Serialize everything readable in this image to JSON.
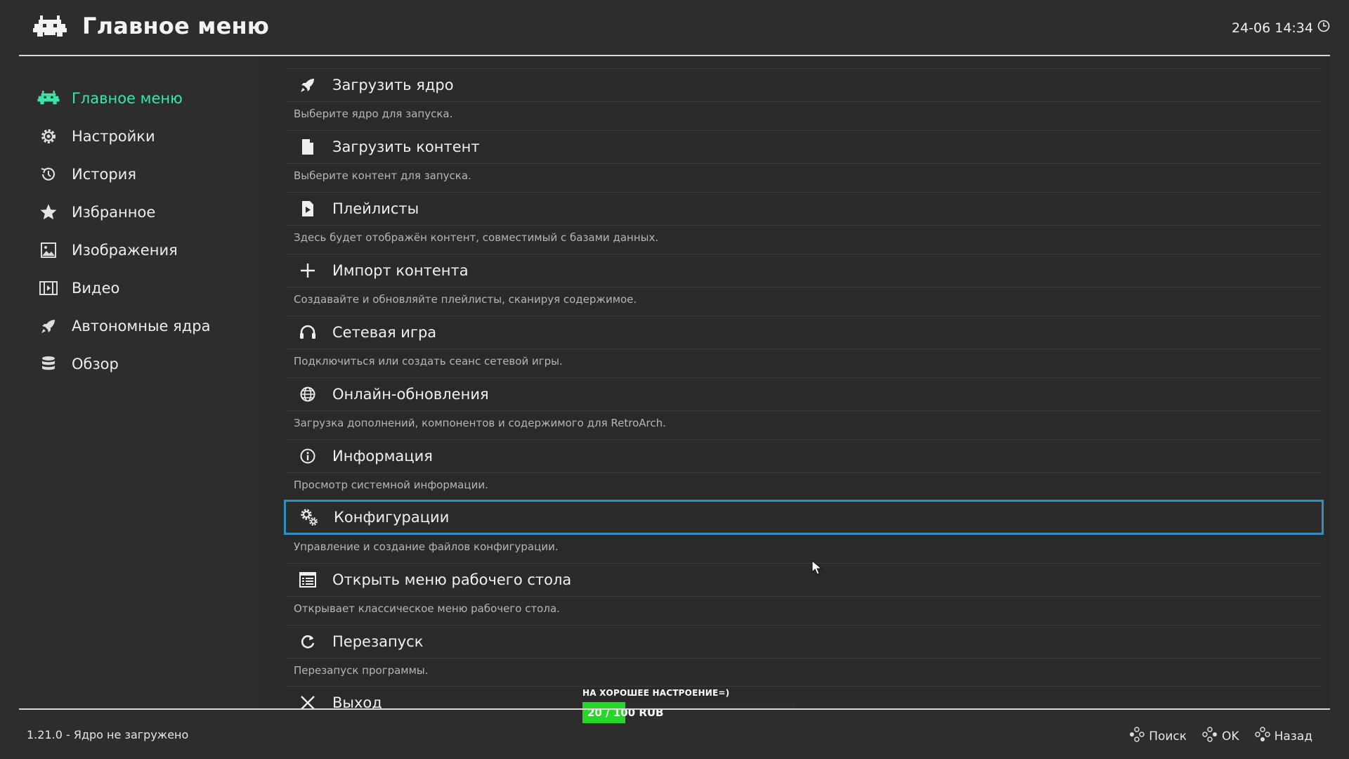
{
  "header": {
    "title": "Главное меню",
    "clock": "24-06 14:34",
    "logo_icon": "retroarch-invader-icon",
    "clock_icon": "clock-icon"
  },
  "sidebar": {
    "items": [
      {
        "label": "Главное меню",
        "icon": "retroarch-invader-icon",
        "active": true
      },
      {
        "label": "Настройки",
        "icon": "gear-icon"
      },
      {
        "label": "История",
        "icon": "history-icon"
      },
      {
        "label": "Избранное",
        "icon": "star-icon"
      },
      {
        "label": "Изображения",
        "icon": "image-icon"
      },
      {
        "label": "Видео",
        "icon": "film-icon"
      },
      {
        "label": "Автономные ядра",
        "icon": "rocket-icon"
      },
      {
        "label": "Обзор",
        "icon": "database-icon"
      }
    ],
    "active_color": "#3ae6a8"
  },
  "menu": {
    "items": [
      {
        "label": "Загрузить ядро",
        "desc": "Выберите ядро для запуска.",
        "icon": "rocket-icon"
      },
      {
        "label": "Загрузить контент",
        "desc": "Выберите контент для запуска.",
        "icon": "file-icon"
      },
      {
        "label": "Плейлисты",
        "desc": "Здесь будет отображён контент, совместимый с базами данных.",
        "icon": "playlist-icon"
      },
      {
        "label": "Импорт контента",
        "desc": "Создавайте и обновляйте плейлисты, сканируя содержимое.",
        "icon": "plus-icon"
      },
      {
        "label": "Сетевая игра",
        "desc": "Подключиться или создать сеанс сетевой игры.",
        "icon": "headset-icon"
      },
      {
        "label": "Онлайн-обновления",
        "desc": "Загрузка дополнений, компонентов и содержимого для RetroArch.",
        "icon": "globe-icon"
      },
      {
        "label": "Информация",
        "desc": "Просмотр системной информации.",
        "icon": "info-icon"
      },
      {
        "label": "Конфигурации",
        "desc": "Управление и создание файлов конфигурации.",
        "icon": "gears-icon",
        "selected": true
      },
      {
        "label": "Открыть меню рабочего стола",
        "desc": "Открывает классическое меню рабочего стола.",
        "icon": "list-icon"
      },
      {
        "label": "Перезапуск",
        "desc": "Перезапуск программы.",
        "icon": "restart-icon"
      },
      {
        "label": "Выход",
        "icon": "close-icon"
      }
    ],
    "selection_color": "#2f8fc0"
  },
  "footer": {
    "version": "1.21.0 - Ядро не загружено",
    "hints": [
      {
        "label": "Поиск",
        "icon": "gamepad-button-icon"
      },
      {
        "label": "OK",
        "icon": "gamepad-button-icon"
      },
      {
        "label": "Назад",
        "icon": "gamepad-button-icon"
      }
    ]
  },
  "donation": {
    "title": "НА ХОРОШЕЕ НАСТРОЕНИЕ=)",
    "amount_text": "20 / 100 RUB",
    "progress": 0.2,
    "fill_color": "#26d629"
  }
}
